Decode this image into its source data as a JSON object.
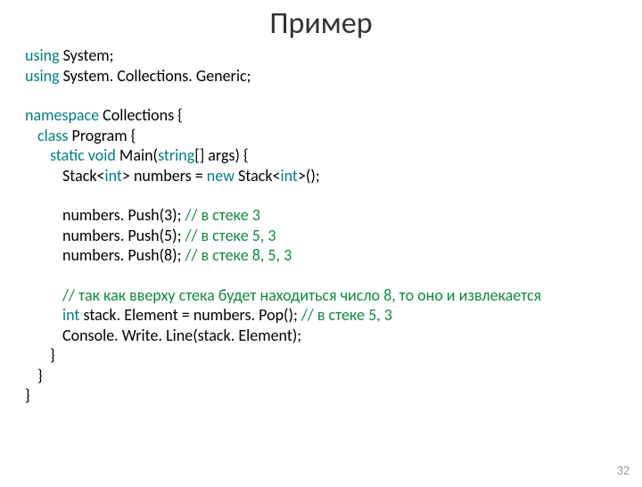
{
  "title": "Пример",
  "page_number": "32",
  "lines": [
    {
      "indent": 0,
      "segments": [
        {
          "t": "using",
          "c": "kw"
        },
        {
          "t": " System;"
        }
      ]
    },
    {
      "indent": 0,
      "segments": [
        {
          "t": "using",
          "c": "kw"
        },
        {
          "t": " System. Collections. Generic;"
        }
      ]
    },
    {
      "blank": true
    },
    {
      "indent": 0,
      "segments": [
        {
          "t": "namespace",
          "c": "kw"
        },
        {
          "t": " Collections {"
        }
      ]
    },
    {
      "indent": 1,
      "segments": [
        {
          "t": "class",
          "c": "kw"
        },
        {
          "t": " Program {"
        }
      ]
    },
    {
      "indent": 2,
      "segments": [
        {
          "t": "static void",
          "c": "kw"
        },
        {
          "t": " Main("
        },
        {
          "t": "string",
          "c": "kw"
        },
        {
          "t": "[] args) {"
        }
      ]
    },
    {
      "indent": 3,
      "segments": [
        {
          "t": "Stack<"
        },
        {
          "t": "int",
          "c": "kw"
        },
        {
          "t": "> numbers = "
        },
        {
          "t": "new",
          "c": "kw"
        },
        {
          "t": " Stack<"
        },
        {
          "t": "int",
          "c": "kw"
        },
        {
          "t": ">();"
        }
      ]
    },
    {
      "blank": true
    },
    {
      "indent": 3,
      "segments": [
        {
          "t": "numbers. Push(3); "
        },
        {
          "t": "// в стеке 3",
          "c": "cm"
        }
      ]
    },
    {
      "indent": 3,
      "segments": [
        {
          "t": "numbers. Push(5); "
        },
        {
          "t": "// в стеке 5, 3",
          "c": "cm"
        }
      ]
    },
    {
      "indent": 3,
      "segments": [
        {
          "t": "numbers. Push(8); "
        },
        {
          "t": "// в стеке 8, 5, 3",
          "c": "cm"
        }
      ]
    },
    {
      "blank": true
    },
    {
      "indent": 3,
      "segments": [
        {
          "t": "// так как вверху стека будет находиться число 8, то оно и извлекается",
          "c": "cm"
        }
      ]
    },
    {
      "indent": 3,
      "segments": [
        {
          "t": "int",
          "c": "kw"
        },
        {
          "t": " stack. Element = numbers. Pop(); "
        },
        {
          "t": "// в стеке 5, 3",
          "c": "cm"
        }
      ]
    },
    {
      "indent": 3,
      "segments": [
        {
          "t": "Console. Write. Line(stack. Element);"
        }
      ]
    },
    {
      "indent": 2,
      "segments": [
        {
          "t": "}"
        }
      ]
    },
    {
      "indent": 1,
      "segments": [
        {
          "t": "}"
        }
      ]
    },
    {
      "indent": 0,
      "segments": [
        {
          "t": "}"
        }
      ]
    }
  ]
}
